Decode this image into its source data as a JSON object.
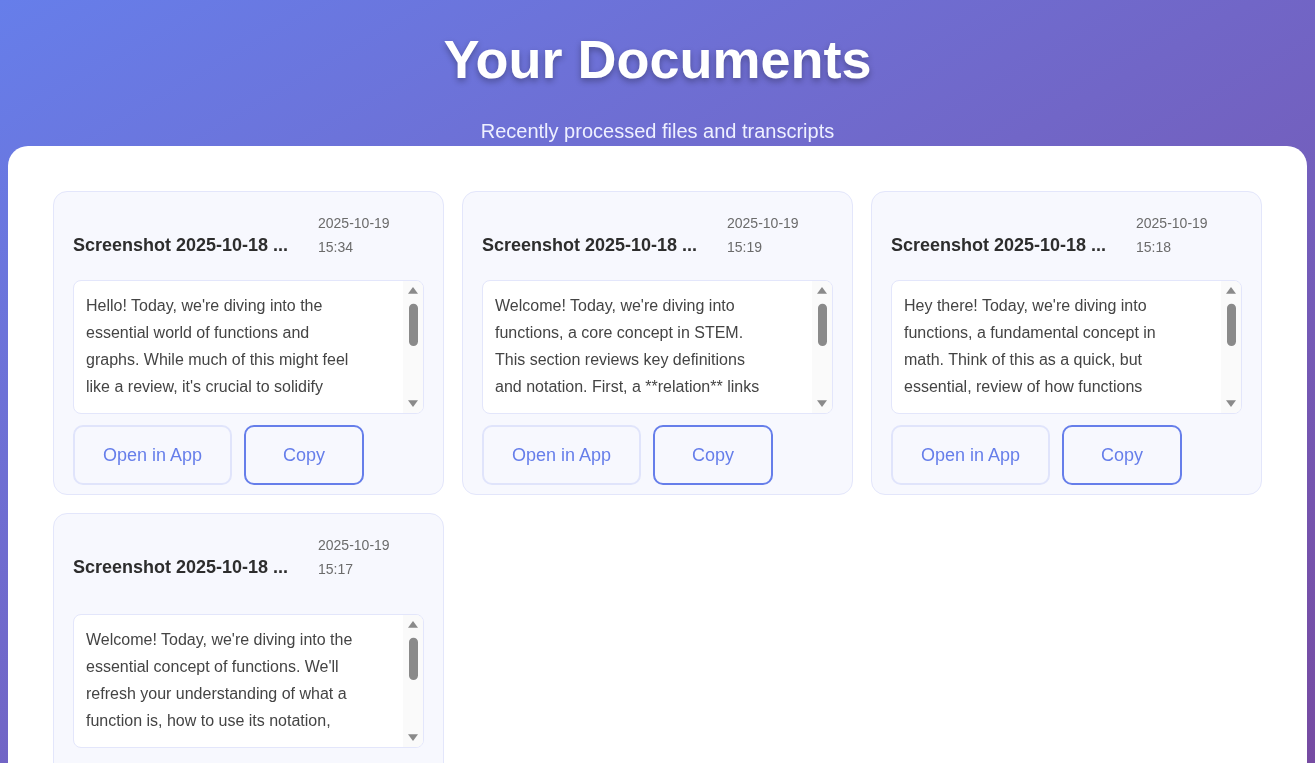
{
  "header": {
    "title": "Your Documents",
    "subtitle": "Recently processed files and transcripts"
  },
  "documents": [
    {
      "name": "Screenshot 2025-10-18 ...",
      "date": "2025-10-19",
      "time": "15:34",
      "transcript_lines": [
        "Hello! Today, we're diving into the",
        "essential world of functions and",
        "graphs. While much of this might feel",
        "like a review, it's crucial to solidify"
      ],
      "actions": [
        "Open in App",
        "Copy"
      ]
    },
    {
      "name": "Screenshot 2025-10-18 ...",
      "date": "2025-10-19",
      "time": "15:19",
      "transcript_lines": [
        "Welcome! Today, we're diving into",
        "functions, a core concept in STEM.",
        "This section reviews key definitions",
        "and notation. First, a **relation** links"
      ],
      "actions": [
        "Open in App",
        "Copy"
      ]
    },
    {
      "name": "Screenshot 2025-10-18 ...",
      "date": "2025-10-19",
      "time": "15:18",
      "transcript_lines": [
        "Hey there! Today, we're diving into",
        "functions, a fundamental concept in",
        "math. Think of this as a quick, but",
        "essential, review of how functions"
      ],
      "actions": [
        "Open in App",
        "Copy"
      ]
    },
    {
      "name": "Screenshot 2025-10-18 ...",
      "date": "2025-10-19",
      "time": "15:17",
      "transcript_lines": [
        "Welcome! Today, we're diving into the",
        "essential concept of functions. We'll",
        "refresh your understanding of what a",
        "function is, how to use its notation,"
      ]
    }
  ]
}
